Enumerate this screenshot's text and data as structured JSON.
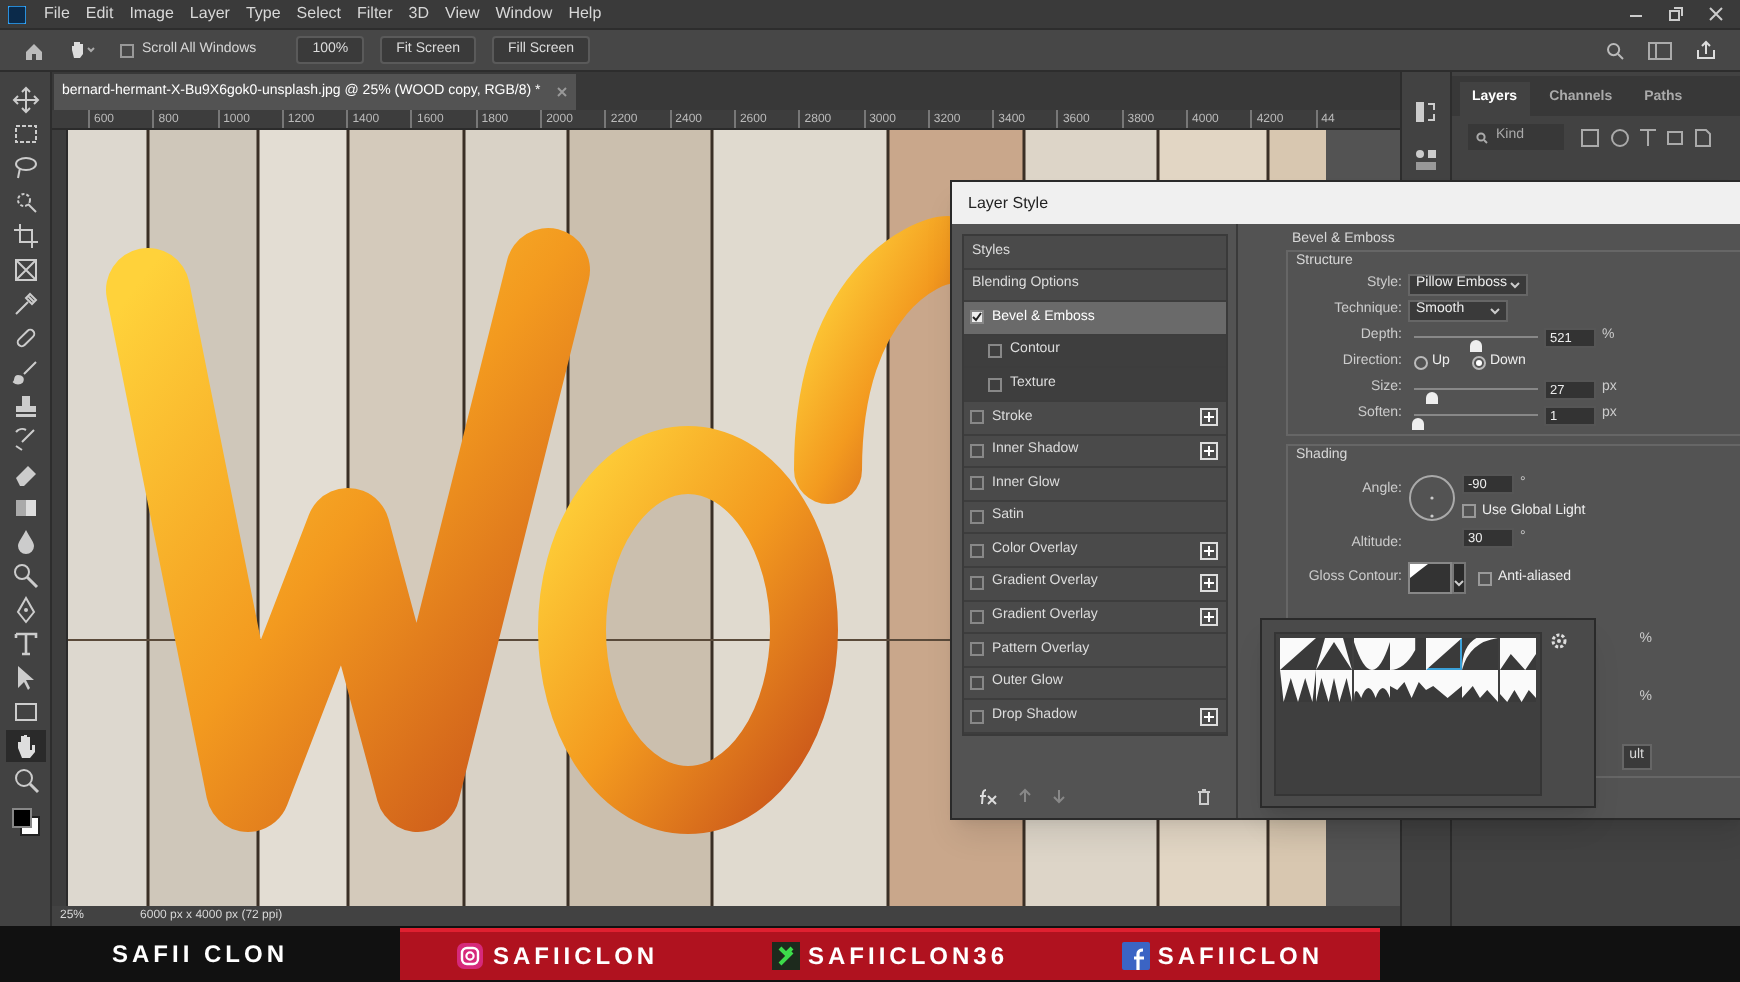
{
  "menu_bar": {
    "items": [
      "File",
      "Edit",
      "Image",
      "Layer",
      "Type",
      "Select",
      "Filter",
      "3D",
      "View",
      "Window",
      "Help"
    ]
  },
  "options_bar": {
    "scroll_all_windows": {
      "label": "Scroll All Windows",
      "checked": false
    },
    "buttons": [
      "100%",
      "Fit Screen",
      "Fill Screen"
    ]
  },
  "toolbar": {
    "tools": [
      {
        "kind": "move",
        "selected": false
      },
      {
        "kind": "marquee",
        "selected": false
      },
      {
        "kind": "lasso",
        "selected": false
      },
      {
        "kind": "select",
        "selected": false
      },
      {
        "kind": "crop",
        "selected": false
      },
      {
        "kind": "frame",
        "selected": false
      },
      {
        "kind": "eyedropper",
        "selected": false
      },
      {
        "kind": "healing",
        "selected": false
      },
      {
        "kind": "brush",
        "selected": false
      },
      {
        "kind": "stamp",
        "selected": false
      },
      {
        "kind": "history",
        "selected": false
      },
      {
        "kind": "eraser",
        "selected": false
      },
      {
        "kind": "gradient",
        "selected": false
      },
      {
        "kind": "blur",
        "selected": false
      },
      {
        "kind": "dodge",
        "selected": false
      },
      {
        "kind": "pen",
        "selected": false
      },
      {
        "kind": "type",
        "selected": false
      },
      {
        "kind": "path",
        "selected": false
      },
      {
        "kind": "shape",
        "selected": false
      },
      {
        "kind": "hand",
        "selected": true
      },
      {
        "kind": "zoom",
        "selected": false
      }
    ]
  },
  "document_tab": {
    "title": "bernard-hermant-X-Bu9X6gok0-unsplash.jpg @ 25% (WOOD copy, RGB/8) *"
  },
  "ruler": {
    "labels": [
      "600",
      "800",
      "1000",
      "1200",
      "1400",
      "1600",
      "1800",
      "2000",
      "2200",
      "2400",
      "2600",
      "2800",
      "3000",
      "3200",
      "3400",
      "3600",
      "3800",
      "4000",
      "4200",
      "44"
    ]
  },
  "layers_panel": {
    "tabs": [
      {
        "label": "Layers",
        "selected": true
      },
      {
        "label": "Channels",
        "selected": false
      },
      {
        "label": "Paths",
        "selected": false
      }
    ],
    "search": {
      "placeholder": "Kind"
    }
  },
  "layer_style": {
    "title": "Layer Style",
    "effects": [
      {
        "label": "Styles",
        "kind": "header",
        "selected": false
      },
      {
        "label": "Blending Options",
        "kind": "header",
        "selected": false
      },
      {
        "label": "Bevel & Emboss",
        "kind": "effect",
        "checked": true,
        "selected": true,
        "addable": false
      },
      {
        "label": "Contour",
        "kind": "sub",
        "checked": false,
        "selected": false
      },
      {
        "label": "Texture",
        "kind": "sub",
        "checked": false,
        "selected": false
      },
      {
        "label": "Stroke",
        "kind": "effect",
        "checked": false,
        "selected": false,
        "addable": true
      },
      {
        "label": "Inner Shadow",
        "kind": "effect",
        "checked": false,
        "selected": false,
        "addable": true
      },
      {
        "label": "Inner Glow",
        "kind": "effect",
        "checked": false,
        "selected": false,
        "addable": false
      },
      {
        "label": "Satin",
        "kind": "effect",
        "checked": false,
        "selected": false,
        "addable": false
      },
      {
        "label": "Color Overlay",
        "kind": "effect",
        "checked": false,
        "selected": false,
        "addable": true
      },
      {
        "label": "Gradient Overlay",
        "kind": "effect",
        "checked": false,
        "selected": false,
        "addable": true
      },
      {
        "label": "Gradient Overlay",
        "kind": "effect",
        "checked": false,
        "selected": false,
        "addable": true
      },
      {
        "label": "Pattern Overlay",
        "kind": "effect",
        "checked": false,
        "selected": false,
        "addable": false
      },
      {
        "label": "Outer Glow",
        "kind": "effect",
        "checked": false,
        "selected": false,
        "addable": false
      },
      {
        "label": "Drop Shadow",
        "kind": "effect",
        "checked": false,
        "selected": false,
        "addable": true
      }
    ],
    "heading": "Bevel & Emboss",
    "structure": {
      "title": "Structure",
      "style": {
        "label": "Style:",
        "value": "Pillow Emboss"
      },
      "technique": {
        "label": "Technique:",
        "value": "Smooth"
      },
      "depth": {
        "label": "Depth:",
        "level": 0.5,
        "value": "521",
        "unit": "%"
      },
      "direction": {
        "label": "Direction:",
        "options": [
          {
            "label": "Up",
            "selected": false
          },
          {
            "label": "Down",
            "selected": true
          }
        ]
      },
      "size": {
        "label": "Size:",
        "level": 0.15,
        "value": "27",
        "unit": "px"
      },
      "soften": {
        "label": "Soften:",
        "level": 0.04,
        "value": "1",
        "unit": "px"
      }
    },
    "shading": {
      "title": "Shading",
      "angle": {
        "label": "Angle:",
        "value": "-90",
        "unit": "°"
      },
      "global_light": {
        "label": "Use Global Light",
        "checked": false
      },
      "altitude": {
        "label": "Altitude:",
        "value": "30",
        "unit": "°"
      },
      "gloss_contour": {
        "label": "Gloss Contour:"
      },
      "anti_aliased": {
        "label": "Anti-aliased",
        "checked": false
      }
    },
    "contour_picker": {
      "presets": [
        {
          "selected": false
        },
        {
          "selected": false
        },
        {
          "selected": false
        },
        {
          "selected": false
        },
        {
          "selected": true
        },
        {
          "selected": false
        },
        {
          "selected": false
        },
        {
          "selected": false
        },
        {
          "selected": false
        },
        {
          "selected": false
        },
        {
          "selected": false
        },
        {
          "selected": false
        },
        {
          "selected": false
        },
        {
          "selected": false
        }
      ]
    },
    "hidden_fragments": [
      "%",
      "%",
      "ult"
    ]
  },
  "status_bar": {
    "zoom": "25%",
    "size": "6000 px x 4000 px (72 ppi)"
  },
  "banner": {
    "name": "SAFII CLON",
    "socials": [
      {
        "kind": "instagram",
        "handle": "SAFIICLON"
      },
      {
        "kind": "tiktok",
        "handle": "SAFIICLON36"
      },
      {
        "kind": "facebook",
        "handle": "SAFIICLON"
      }
    ]
  }
}
